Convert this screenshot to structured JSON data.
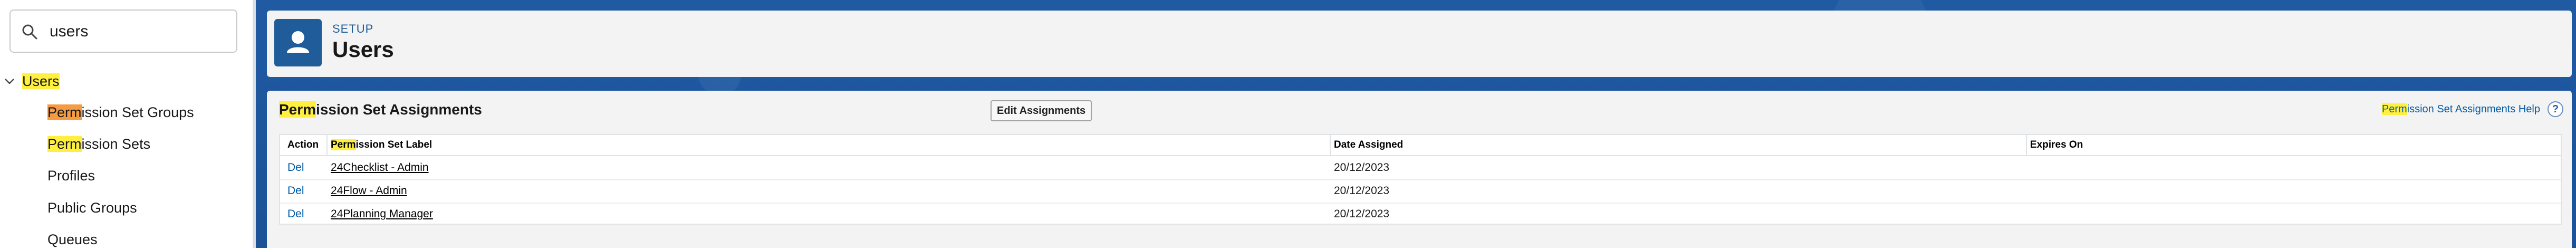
{
  "sidebar": {
    "search": {
      "value": "users"
    },
    "tree": {
      "root": {
        "match": "Users",
        "rest": ""
      },
      "items": [
        {
          "match": "Perm",
          "rest": "ission Set Groups",
          "highlight": "orange"
        },
        {
          "match": "Perm",
          "rest": "ission Sets",
          "highlight": "yellow"
        },
        {
          "match": "",
          "rest": "Profiles",
          "highlight": "none"
        },
        {
          "match": "",
          "rest": "Public Groups",
          "highlight": "none"
        },
        {
          "match": "",
          "rest": "Queues",
          "highlight": "none"
        }
      ]
    }
  },
  "header": {
    "eyebrow": "SETUP",
    "title": "Users",
    "icon": "user-icon"
  },
  "section": {
    "title_match": "Perm",
    "title_rest": "ission Set Assignments",
    "edit_button": "Edit Assignments",
    "help_match": "Perm",
    "help_rest": "ission Set Assignments Help",
    "help_icon": "?"
  },
  "table": {
    "headers": {
      "action": "Action",
      "label_match": "Perm",
      "label_rest": "ission Set Label",
      "date": "Date Assigned",
      "expires": "Expires On"
    },
    "rows": [
      {
        "action": "Del",
        "label": "24Checklist - Admin",
        "date": "20/12/2023",
        "expires": ""
      },
      {
        "action": "Del",
        "label": "24Flow - Admin",
        "date": "20/12/2023",
        "expires": ""
      },
      {
        "action": "Del",
        "label": "24Planning Manager",
        "date": "20/12/2023",
        "expires": ""
      }
    ]
  },
  "colors": {
    "highlight_yellow": "#fff03f",
    "highlight_orange": "#f59b42",
    "link_blue": "#015ba7",
    "header_background_blue": "#1b5297"
  }
}
